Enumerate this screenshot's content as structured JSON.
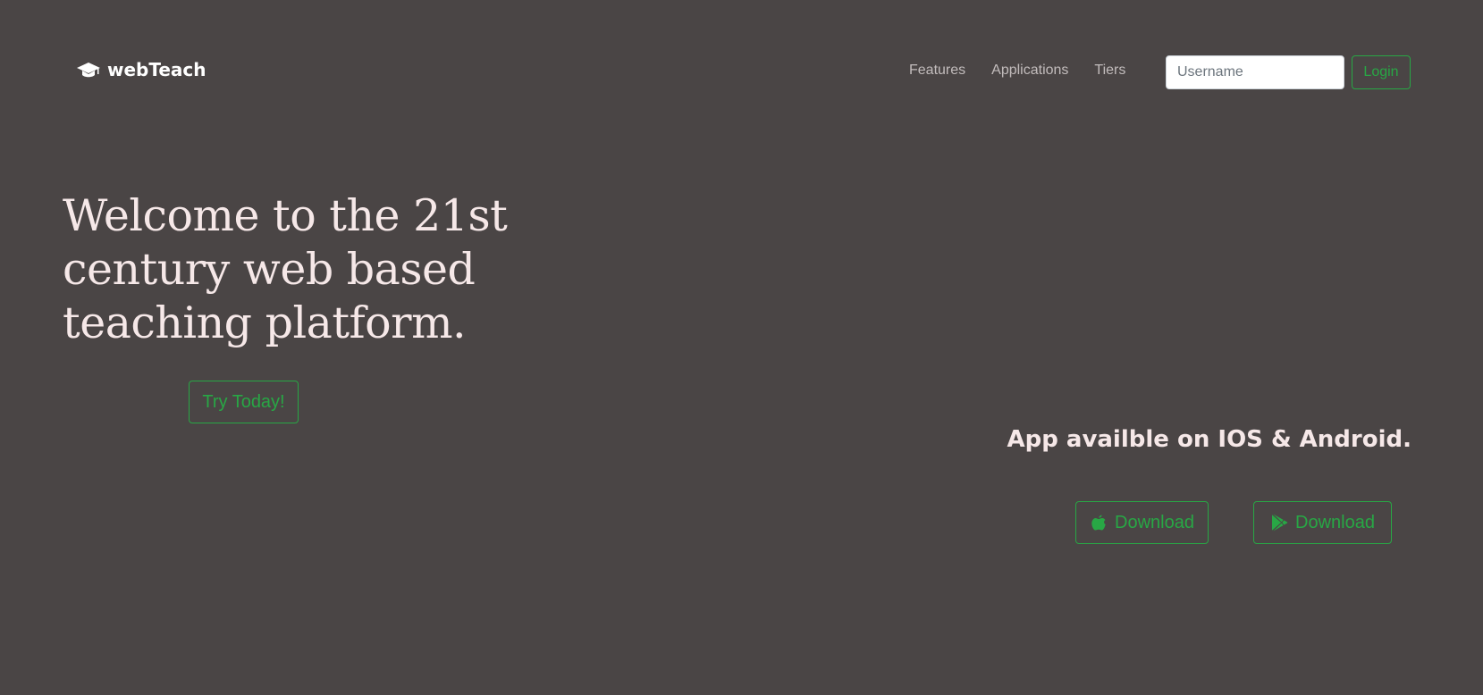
{
  "navbar": {
    "brand": {
      "icon": "graduation-cap-icon",
      "label": "webTeach"
    },
    "links": [
      {
        "label": "Features"
      },
      {
        "label": "Applications"
      },
      {
        "label": "Tiers"
      }
    ],
    "search": {
      "placeholder": "Username",
      "value": ""
    },
    "login_label": "Login"
  },
  "hero": {
    "heading": "Welcome to the 21st century web based teaching platform.",
    "cta_label": "Try Today!"
  },
  "apps": {
    "text": "App availble on IOS & Android.",
    "ios": {
      "icon": "apple-icon",
      "label": "Download"
    },
    "android": {
      "icon": "google-play-icon",
      "label": "Download"
    }
  },
  "colors": {
    "background": "#4a4545",
    "accent": "#28a745",
    "heading_text": "#f6e8e8",
    "nav_text": "#c2bcbc"
  }
}
